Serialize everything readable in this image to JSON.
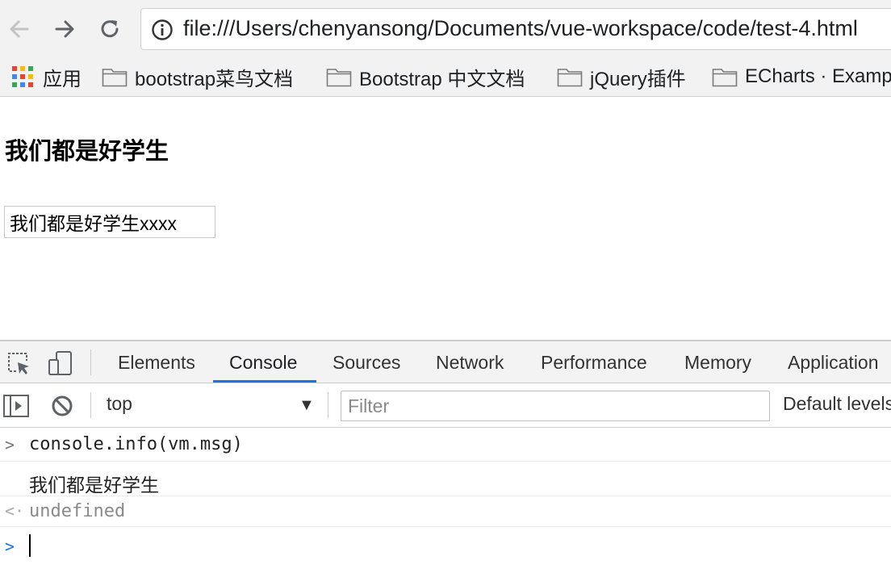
{
  "browser": {
    "url": "file:///Users/chenyansong/Documents/vue-workspace/code/test-4.html",
    "bookmarks": [
      {
        "label": "应用",
        "type": "apps"
      },
      {
        "label": "bootstrap菜鸟文档",
        "type": "folder"
      },
      {
        "label": "Bootstrap 中文文档",
        "type": "folder"
      },
      {
        "label": "jQuery插件",
        "type": "folder"
      },
      {
        "label": "ECharts · Examples",
        "type": "folder"
      }
    ],
    "icons": [
      "back-arrow-icon",
      "forward-arrow-icon",
      "reload-icon",
      "info-icon",
      "apps-grid-icon",
      "folder-icon"
    ]
  },
  "page": {
    "heading": "我们都是好学生",
    "input_value": "我们都是好学生xxxx"
  },
  "devtools": {
    "tabs": [
      "Elements",
      "Console",
      "Sources",
      "Network",
      "Performance",
      "Memory",
      "Application"
    ],
    "active_tab": "Console",
    "accent_color": "#1a73e8",
    "context": "top",
    "filter_placeholder": "Filter",
    "levels": "Default levels",
    "icons": [
      "inspect-element-icon",
      "device-toggle-icon",
      "sidebar-toggle-icon",
      "clear-console-icon",
      "dropdown-arrow-icon"
    ]
  },
  "console": {
    "command": "console.info(vm.msg)",
    "output": "我们都是好学生",
    "return_value": "undefined"
  }
}
